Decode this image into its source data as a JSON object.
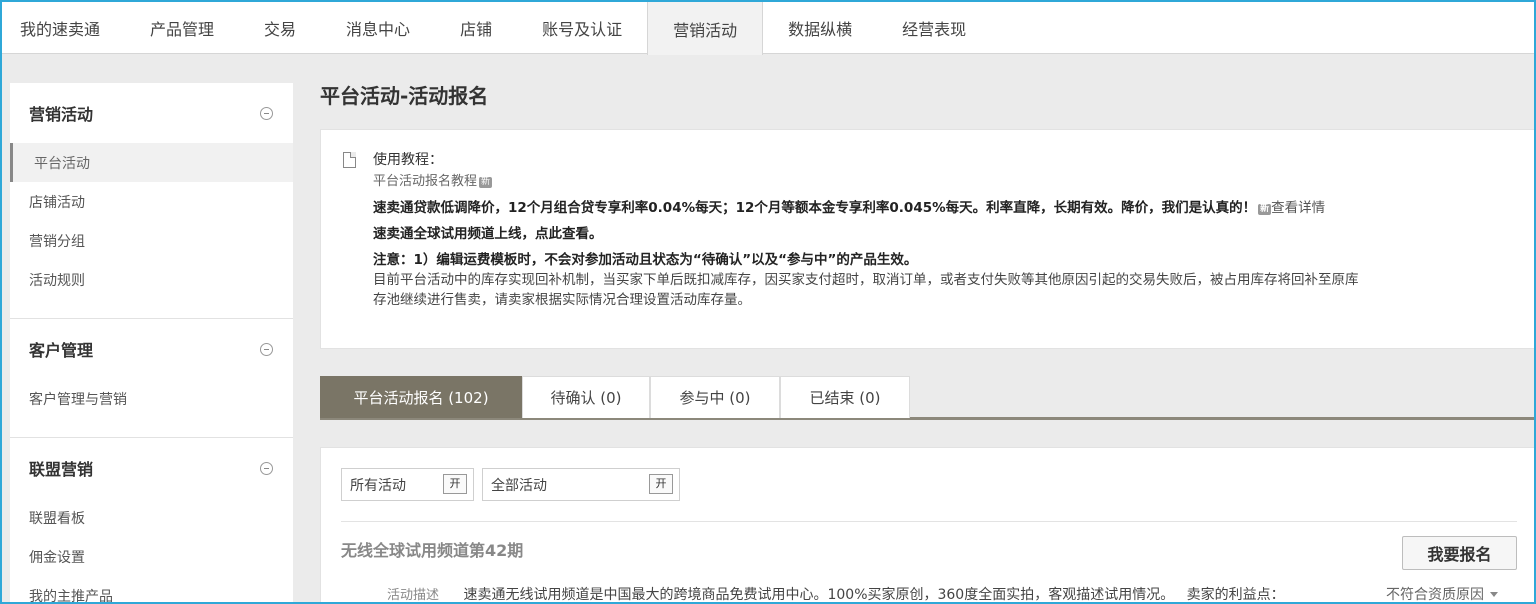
{
  "topnav": {
    "items": [
      "我的速卖通",
      "产品管理",
      "交易",
      "消息中心",
      "店铺",
      "账号及认证",
      "营销活动",
      "数据纵横",
      "经营表现"
    ],
    "active_index": 6
  },
  "sidebar": {
    "groups": [
      {
        "title": "营销活动",
        "items": [
          "平台活动",
          "店铺活动",
          "营销分组",
          "活动规则"
        ],
        "active_index": 0
      },
      {
        "title": "客户管理",
        "items": [
          "客户管理与营销"
        ]
      },
      {
        "title": "联盟营销",
        "items": [
          "联盟看板",
          "佣金设置",
          "我的主推产品"
        ]
      }
    ]
  },
  "main": {
    "title": "平台活动-活动报名",
    "notice": {
      "tutorial_label": "使用教程：",
      "tutorial_link": "平台活动报名教程",
      "new_badge": "新",
      "promo_line": "速卖通贷款低调降价，12个月组合贷专享利率0.04%每天；12个月等额本金专享利率0.045%每天。利率直降，长期有效。降价，我们是认真的！",
      "promo_link": "查看详情",
      "trial_line": "速卖通全球试用频道上线，点此查看。",
      "note_line": "注意：1）编辑运费模板时，不会对参加活动且状态为“待确认”以及“参与中”的产品生效。",
      "stock_line_1": "目前平台活动中的库存实现回补机制，当买家下单后既扣减库存，因买家支付超时，取消订单，或者支付失败等其他原因引起的交易失败后，被占用库存将回补至原库",
      "stock_line_2": "存池继续进行售卖，请卖家根据实际情况合理设置活动库存量。"
    },
    "tabs": [
      {
        "label": "平台活动报名 (102)"
      },
      {
        "label": "待确认 (0)"
      },
      {
        "label": "参与中 (0)"
      },
      {
        "label": "已结束 (0)"
      }
    ],
    "filters": {
      "filter1": "所有活动",
      "filter2": "全部活动",
      "button_label": "开"
    },
    "activity": {
      "title": "无线全球试用频道第42期",
      "signup_label": "我要报名",
      "desc_label": "活动描述",
      "desc_text": "速卖通无线试用频道是中国最大的跨境商品免费试用中心。100%买家原创，360度全面实拍，客观描述试用情况。",
      "benefit_label": "卖家的利益点：",
      "reason_label": "不符合资质原因"
    }
  },
  "colors": {
    "frame_border": "#2fa8d8",
    "active_tab": "#7a7566",
    "page_bg": "#ebebeb"
  }
}
